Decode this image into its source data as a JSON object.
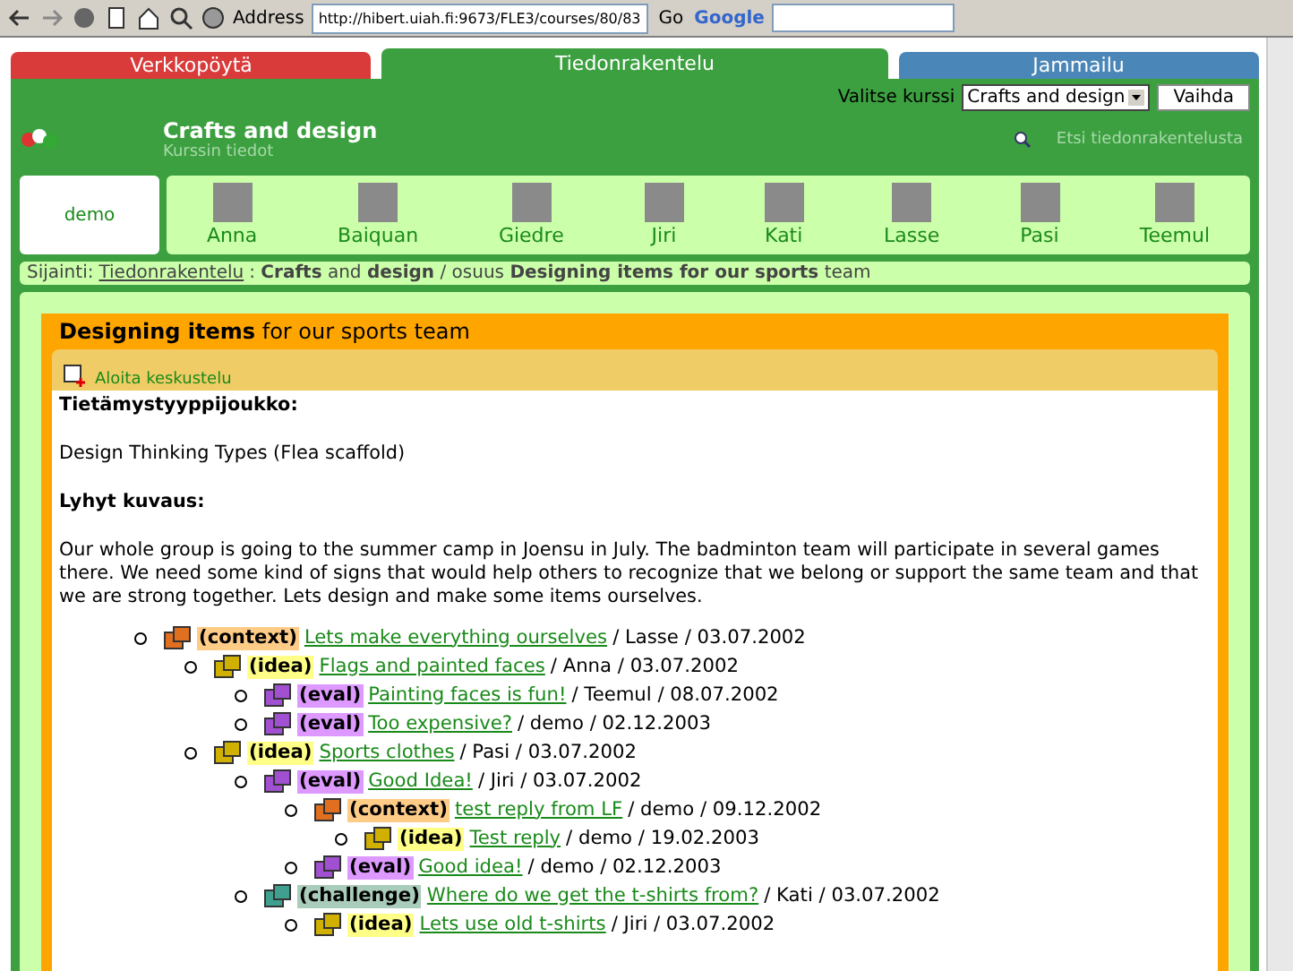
{
  "browser": {
    "address_label": "Address",
    "url": "http://hibert.uiah.fi:9673/FLE3/courses/80/83",
    "go": "Go",
    "search_brand": "Google"
  },
  "tabs": [
    {
      "label": "Verkkopöytä",
      "color": "#d93a3a",
      "selected": false
    },
    {
      "label": "Tiedonrakentelu",
      "color": "#3ca040",
      "selected": true
    },
    {
      "label": "Jammailu",
      "color": "#4a86b8",
      "selected": false
    }
  ],
  "course_select": {
    "label": "Valitse kurssi",
    "value": "Crafts and design",
    "button": "Vaihda"
  },
  "header": {
    "title": "Crafts and design",
    "subtitle": "Kurssin tiedot",
    "search_link": "Etsi tiedonrakentelusta"
  },
  "current_user": "demo",
  "members": [
    "Anna",
    "Baiquan",
    "Giedre",
    "Jiri",
    "Kati",
    "Lasse",
    "Pasi",
    "Teemul"
  ],
  "breadcrumb": {
    "label": "Sijainti:",
    "link": "Tiedonrakentelu",
    "rest": ": **Crafts** and **design** / osuus **Designing items for our sports** team"
  },
  "thread": {
    "title": "**Designing items** for our sports team",
    "start_link": "Aloita keskustelu",
    "type_heading": "Tietämystyyppijoukko:",
    "type_value": "Design Thinking Types (Flea scaffold)",
    "desc_heading": "Lyhyt kuvaus:",
    "description": "Our whole group is going to the summer camp in Joensu in July. The badminton team will participate in several games there. We need some kind of signs that would help others to recognize that we belong or support the same team and that we are strong together. Lets design and make some items ourselves."
  },
  "notes": [
    {
      "kind": "context",
      "tag": "(context)",
      "title": "Lets make everything ourselves",
      "meta": "/ Lasse / 03.07.2002",
      "children": [
        {
          "kind": "idea",
          "tag": "(idea)",
          "title": "Flags and painted faces",
          "meta": "/ Anna / 03.07.2002",
          "children": [
            {
              "kind": "eval",
              "tag": "(eval)",
              "title": "Painting faces is fun!",
              "meta": "/ Teemul / 08.07.2002"
            },
            {
              "kind": "eval",
              "tag": "(eval)",
              "title": "Too expensive?",
              "meta": "/ demo / 02.12.2003"
            }
          ]
        },
        {
          "kind": "idea",
          "tag": "(idea)",
          "title": "Sports clothes",
          "meta": "/ Pasi / 03.07.2002",
          "children": [
            {
              "kind": "eval",
              "tag": "(eval)",
              "title": "Good Idea!",
              "meta": "/ Jiri / 03.07.2002",
              "children": [
                {
                  "kind": "context",
                  "tag": "(context)",
                  "title": "test reply from LF",
                  "meta": "/ demo / 09.12.2002",
                  "children": [
                    {
                      "kind": "idea",
                      "tag": "(idea)",
                      "title": "Test reply",
                      "meta": "/ demo / 19.02.2003"
                    }
                  ]
                },
                {
                  "kind": "eval",
                  "tag": "(eval)",
                  "title": "Good idea!",
                  "meta": "/ demo / 02.12.2003"
                }
              ]
            },
            {
              "kind": "challenge",
              "tag": "(challenge)",
              "title": "Where do we get the t-shirts from?",
              "meta": "/ Kati / 03.07.2002",
              "children": [
                {
                  "kind": "idea",
                  "tag": "(idea)",
                  "title": "Lets use old t-shirts",
                  "meta": "/ Jiri / 03.07.2002"
                }
              ]
            }
          ]
        }
      ]
    }
  ]
}
